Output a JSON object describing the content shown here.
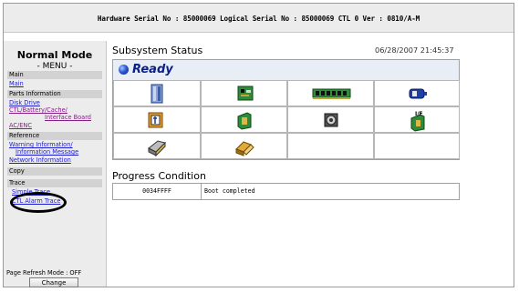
{
  "header": {
    "serial_text": "Hardware Serial No : 85000069  Logical Serial No : 85000069  CTL 0  Ver : 0810/A-M"
  },
  "sidebar": {
    "mode_title": "Normal Mode",
    "menu_title": "- MENU -",
    "sections": [
      {
        "label": "Main"
      },
      {
        "label": "Parts Information"
      },
      {
        "label": "Reference"
      },
      {
        "label": "Copy"
      },
      {
        "label": "Trace"
      }
    ],
    "links": {
      "main": "Main",
      "disk_drive": "Disk Drive",
      "ctl_battery_cache": "CTL/Battery/Cache/",
      "interface_board": "Interface Board",
      "ac_enc": "AC/ENC",
      "warning_information": "Warning Information/",
      "information_message": "Information Message",
      "network_information": "Network Information",
      "simple_trace": "Simple Trace",
      "ctl_alarm_trace": "CTL Alarm Trace"
    },
    "refresh_label": "Page Refresh Mode : OFF",
    "change_label": "Change"
  },
  "main": {
    "subsystem_title": "Subsystem Status",
    "datetime": "06/28/2007 21:45:37",
    "status": "Ready",
    "progress_title": "Progress Condition",
    "progress": {
      "code": "0034FFFF",
      "message": "Boot completed"
    },
    "icons": [
      "disk-drive-icon",
      "controller-board-icon",
      "cache-memory-icon",
      "battery-icon",
      "ac-power-icon",
      "fan-icon",
      "interface-board-icon",
      "enclosure-icon",
      "loop-module-icon"
    ]
  },
  "colors": {
    "ready": "#0b1f88",
    "panel": "#ececec",
    "link": "#1b1bd0",
    "visited_link": "#8a1c8a"
  }
}
